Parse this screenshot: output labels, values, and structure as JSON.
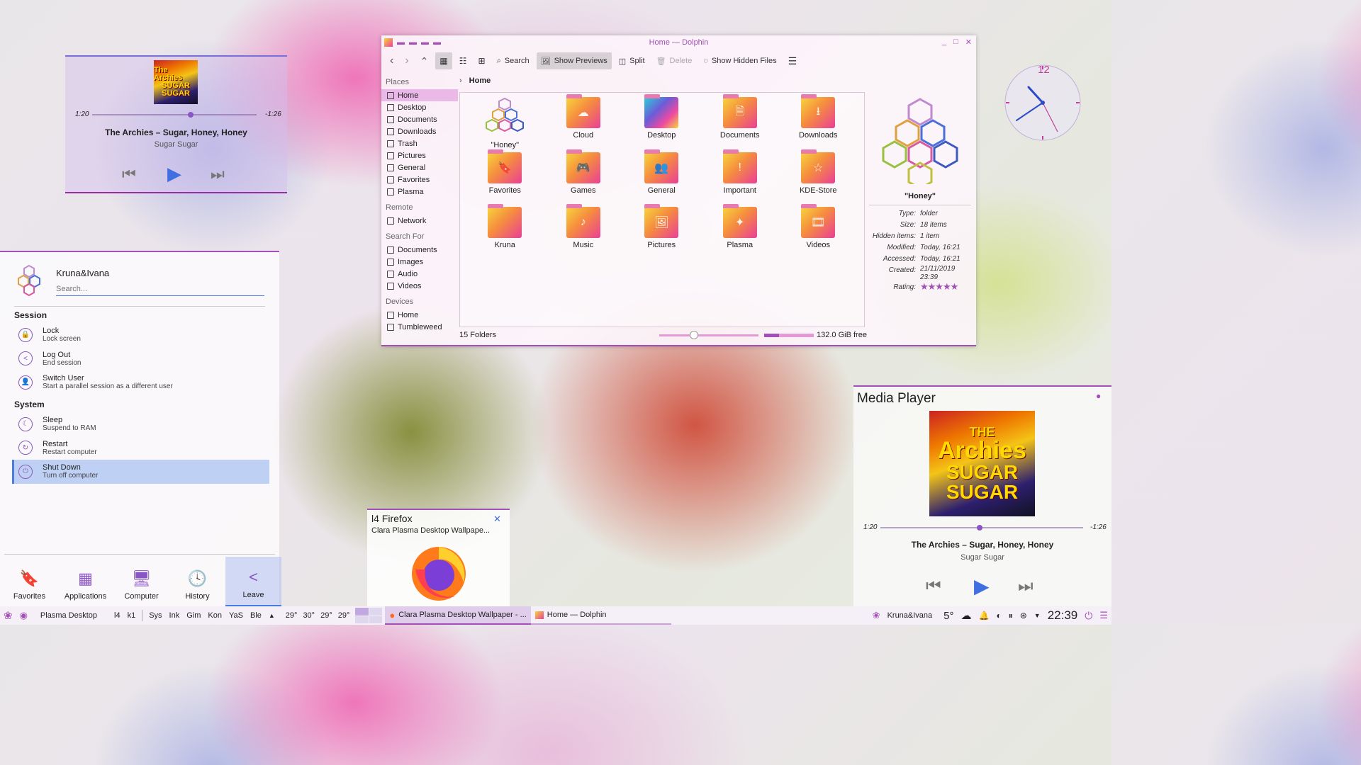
{
  "music_widget": {
    "elapsed": "1:20",
    "remaining": "-1:26",
    "progress": 0.6,
    "title": "The Archies – Sugar, Honey, Honey",
    "album": "Sugar Sugar",
    "cover_line1": "The Archies",
    "cover_line2": "SUGAR",
    "cover_line3": "SUGAR"
  },
  "dolphin": {
    "title": "Home — Dolphin",
    "toolbar": {
      "search": "Search",
      "show_previews": "Show Previews",
      "split": "Split",
      "delete": "Delete",
      "show_hidden": "Show Hidden Files"
    },
    "places": {
      "places_header": "Places",
      "places": [
        "Home",
        "Desktop",
        "Documents",
        "Downloads",
        "Trash",
        "Pictures",
        "General",
        "Favorites",
        "Plasma"
      ],
      "remote_header": "Remote",
      "remote": [
        "Network"
      ],
      "search_header": "Search For",
      "search": [
        "Documents",
        "Images",
        "Audio",
        "Videos"
      ],
      "devices_header": "Devices",
      "devices": [
        "Home",
        "Tumbleweed"
      ]
    },
    "breadcrumb": "Home",
    "folders": [
      {
        "name": "\"Honey\"",
        "glyph": "⬡"
      },
      {
        "name": "Cloud",
        "glyph": "☁"
      },
      {
        "name": "Desktop",
        "glyph": ""
      },
      {
        "name": "Documents",
        "glyph": "🗎"
      },
      {
        "name": "Downloads",
        "glyph": "⭳"
      },
      {
        "name": "Favorites",
        "glyph": "🔖"
      },
      {
        "name": "Games",
        "glyph": "🎮"
      },
      {
        "name": "General",
        "glyph": "👥"
      },
      {
        "name": "Important",
        "glyph": "!"
      },
      {
        "name": "KDE-Store",
        "glyph": "☆"
      },
      {
        "name": "Kruna",
        "glyph": ""
      },
      {
        "name": "Music",
        "glyph": "♪"
      },
      {
        "name": "Pictures",
        "glyph": "🖼"
      },
      {
        "name": "Plasma",
        "glyph": "✦"
      },
      {
        "name": "Videos",
        "glyph": "🎞"
      }
    ],
    "info": {
      "name": "\"Honey\"",
      "rows": [
        {
          "k": "Type:",
          "v": "folder"
        },
        {
          "k": "Size:",
          "v": "18 items"
        },
        {
          "k": "Hidden items:",
          "v": "1 item"
        },
        {
          "k": "Modified:",
          "v": "Today, 16:21"
        },
        {
          "k": "Accessed:",
          "v": "Today, 16:21"
        },
        {
          "k": "Created:",
          "v": "21/11/2019 23:39"
        }
      ],
      "rating_label": "Rating:",
      "rating": 5
    },
    "status": {
      "count": "15 Folders",
      "free": "132.0 GiB free",
      "zoom": 0.35,
      "usage": 0.3
    }
  },
  "kickoff": {
    "user": "Kruna&Ivana",
    "search_placeholder": "Search...",
    "session_header": "Session",
    "system_header": "System",
    "session": [
      {
        "t": "Lock",
        "s": "Lock screen",
        "g": "🔒"
      },
      {
        "t": "Log Out",
        "s": "End session",
        "g": "<"
      },
      {
        "t": "Switch User",
        "s": "Start a parallel session as a different user",
        "g": "👤"
      }
    ],
    "system": [
      {
        "t": "Sleep",
        "s": "Suspend to RAM",
        "g": "☾"
      },
      {
        "t": "Restart",
        "s": "Restart computer",
        "g": "↻"
      },
      {
        "t": "Shut Down",
        "s": "Turn off computer",
        "g": "⏻"
      }
    ],
    "tabs": [
      {
        "l": "Favorites",
        "g": "🔖"
      },
      {
        "l": "Applications",
        "g": "▦"
      },
      {
        "l": "Computer",
        "g": "🖥"
      },
      {
        "l": "History",
        "g": "🕓"
      },
      {
        "l": "Leave",
        "g": "<"
      }
    ]
  },
  "media_player": {
    "header": "Media Player",
    "elapsed": "1:20",
    "remaining": "-1:26",
    "progress": 0.49,
    "title": "The Archies – Sugar, Honey, Honey",
    "album": "Sugar Sugar",
    "cover_line1": "THE",
    "cover_line2": "Archies",
    "cover_line3": "SUGAR",
    "cover_line4": "SUGAR"
  },
  "firefox_tip": {
    "title": "l4 Firefox",
    "subtitle": "Clara Plasma Desktop Wallpape..."
  },
  "clock": {
    "twelve": "12"
  },
  "taskbar": {
    "activity": "Plasma Desktop",
    "pager1": "l4",
    "pager2": "k1",
    "quick": [
      "Sys",
      "Ink",
      "Gim",
      "Kon",
      "YaS",
      "Ble"
    ],
    "temps": [
      "29°",
      "30°",
      "29°",
      "29°"
    ],
    "task1": "Clara Plasma Desktop Wallpaper - ...",
    "task2": "Home — Dolphin",
    "user": "Kruna&Ivana",
    "weather": "5°",
    "time": "22:39"
  },
  "colors": {
    "accent": "#a34fb7",
    "blue": "#3f6fe0"
  }
}
